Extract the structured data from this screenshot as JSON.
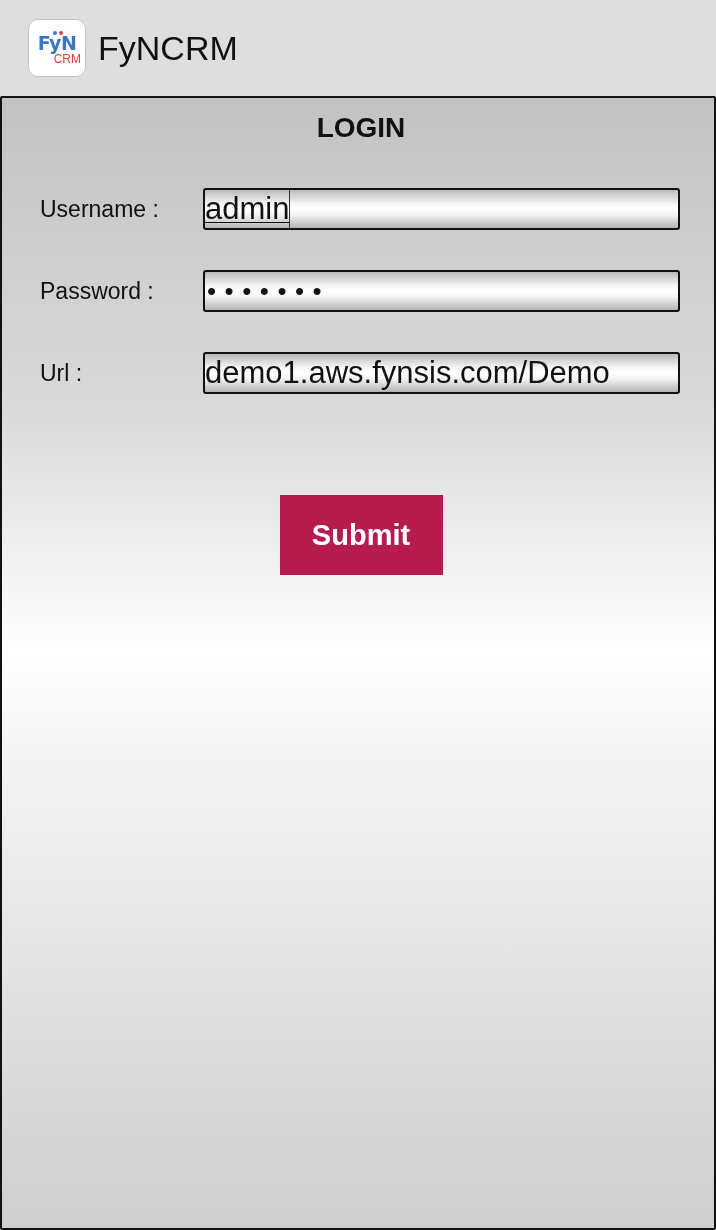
{
  "app_bar": {
    "logo": {
      "wordmark": "FyN",
      "subtitle": "CRM"
    },
    "title": "FyNCRM"
  },
  "login": {
    "heading": "LOGIN",
    "fields": [
      {
        "label": "Username :",
        "value": "admin",
        "kind": "text",
        "focused": true
      },
      {
        "label": "Password :",
        "value": "•••••••",
        "kind": "password",
        "focused": false
      },
      {
        "label": "Url :",
        "value": "demo1.aws.fynsis.com/Demo",
        "kind": "text",
        "focused": false
      }
    ],
    "submit": "Submit"
  }
}
